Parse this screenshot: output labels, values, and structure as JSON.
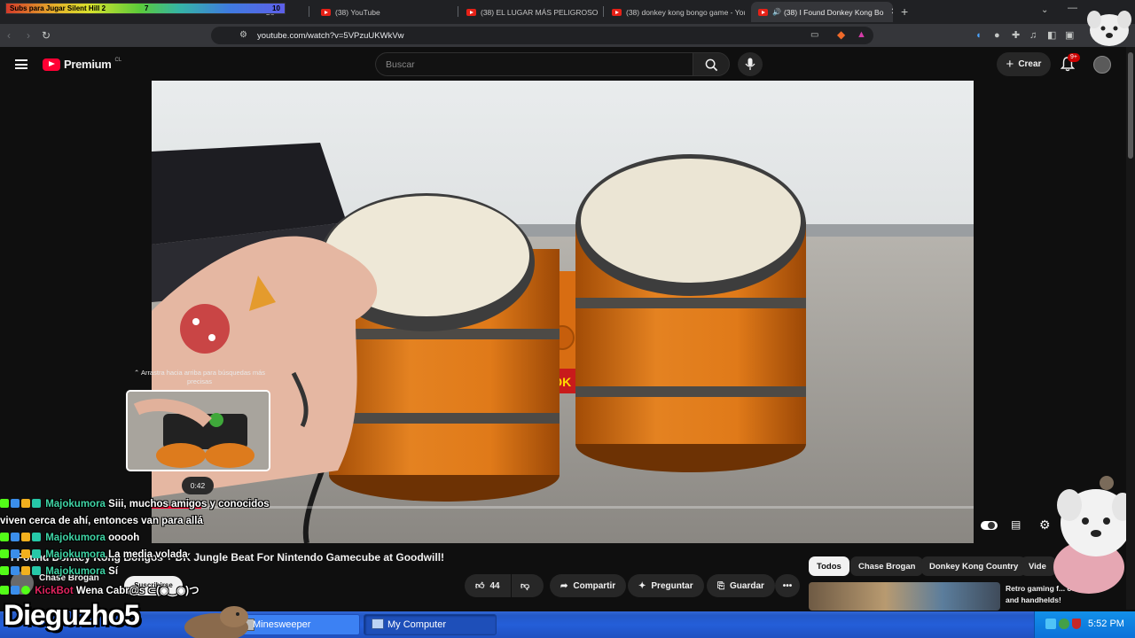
{
  "browser": {
    "tabs": [
      {
        "label": "be",
        "active": false
      },
      {
        "label": "(38) YouTube",
        "active": false
      },
      {
        "label": "(38) EL LUGAR MÁS PELIGROSO PAR",
        "active": false
      },
      {
        "label": "(38) donkey kong bongo game - You",
        "active": false
      },
      {
        "label": "(38) I Found Donkey Kong Bo",
        "active": true
      }
    ],
    "new_tab_symbol": "+",
    "url": "youtube.com/watch?v=5VPzuUKWkVw"
  },
  "overlay": {
    "subs_label": "Subs para Jugar Silent Hill 2",
    "subs_current": "7",
    "subs_goal": "10",
    "streamer_name": "Dieguzho5"
  },
  "youtube": {
    "logo_text": "Premium",
    "region": "CL",
    "search_placeholder": "Buscar",
    "create_label": "Crear",
    "notifications_badge": "9+",
    "video_title": "I Found Donkey Kong Bongos + DK Jungle Beat For Nintendo Gamecube at Goodwill!",
    "channel_name": "Chase Brogan",
    "subscribe_label": "Suscribirse",
    "likes": "44",
    "share_label": "Compartir",
    "ask_label": "Preguntar",
    "save_label": "Guardar",
    "preview_hint": "Arrastra hacia arriba para búsquedas más precisas",
    "preview_time": "0:42",
    "chips": [
      "Todos",
      "Chase Brogan",
      "Donkey Kong Country",
      "Vide"
    ],
    "rec_title": "Retro gaming f... consoles and handhelds!"
  },
  "chat": [
    {
      "name": "Majokumora",
      "msg": "Siii, muchos amigos y conocidos",
      "color": "#3fd4a5"
    },
    {
      "name": "",
      "msg": "viven cerca de ahí, entonces van para allá",
      "color": "#3fd4a5"
    },
    {
      "name": "Majokumora",
      "msg": "ooooh",
      "color": "#3fd4a5"
    },
    {
      "name": "Majokumora",
      "msg": "La media volada",
      "color": "#3fd4a5"
    },
    {
      "name": "Majokumora",
      "msg": "Sí",
      "color": "#3fd4a5"
    },
    {
      "name": "KickBot",
      "msg": "Wena Cabr@s ⊂(◉‿◉)つ",
      "color": "#e0245e"
    }
  ],
  "taskbar": {
    "items": [
      "Minesweeper",
      "My Computer"
    ],
    "clock": "5:52 PM"
  },
  "colors": {
    "youtube_red": "#ff0033",
    "taskbar_blue": "#245ed9",
    "chat_name": "#3fd4a5"
  }
}
